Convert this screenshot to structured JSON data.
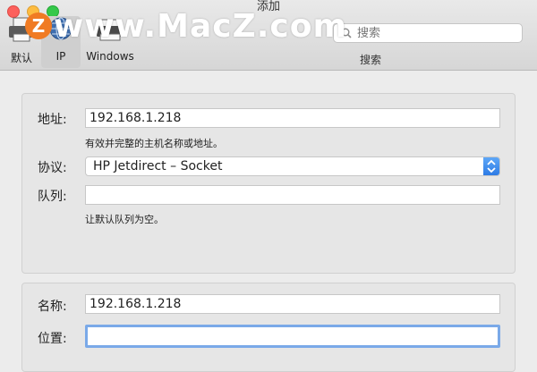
{
  "window": {
    "title": "添加"
  },
  "watermark": {
    "text": "www.MacZ.com",
    "badge": "Z"
  },
  "toolbar": {
    "buttons": [
      {
        "label": "默认",
        "icon": "printer-icon"
      },
      {
        "label": "IP",
        "icon": "globe-icon",
        "selected": true
      },
      {
        "label": "Windows",
        "icon": "windows-printer-icon"
      }
    ],
    "search": {
      "placeholder": "搜索",
      "caption": "搜索"
    }
  },
  "connection": {
    "address": {
      "label": "地址:",
      "value": "192.168.1.218",
      "hint": "有效并完整的主机名称或地址。"
    },
    "protocol": {
      "label": "协议:",
      "value": "HP Jetdirect – Socket"
    },
    "queue": {
      "label": "队列:",
      "value": "",
      "hint": "让默认队列为空。"
    }
  },
  "info": {
    "name": {
      "label": "名称:",
      "value": "192.168.1.218"
    },
    "location": {
      "label": "位置:",
      "value": ""
    }
  },
  "colors": {
    "accent": "#2d7be5",
    "focus_ring": "#7aa9e8",
    "background": "#ececec"
  }
}
